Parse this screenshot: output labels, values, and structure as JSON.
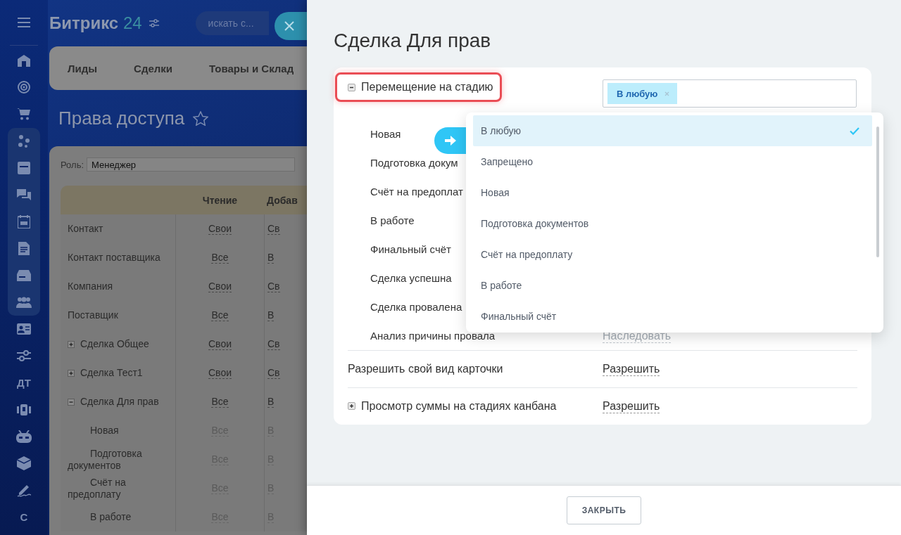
{
  "sidebar": {
    "text_items": [
      "ДТ",
      "С"
    ]
  },
  "header": {
    "logo_text": "Битрикс",
    "logo_number": "24",
    "search": {
      "placeholder": "искать с..."
    }
  },
  "nav_tabs": [
    "Лиды",
    "Сделки",
    "Товары и Склад"
  ],
  "page_title": "Права доступа",
  "role": {
    "label": "Роль:",
    "value": "Менеджер"
  },
  "table": {
    "columns": [
      "Чтение",
      "Добав"
    ],
    "rows": [
      {
        "name": "Контакт",
        "values": [
          "Свои",
          "Св"
        ],
        "inherited": false
      },
      {
        "name": "Контакт поставщика",
        "values": [
          "Все",
          "В"
        ],
        "inherited": false
      },
      {
        "name": "Компания",
        "values": [
          "Свои",
          "Св"
        ],
        "inherited": false
      },
      {
        "name": "Поставщик",
        "values": [
          "Все",
          "В"
        ],
        "inherited": false
      },
      {
        "name": "Сделка Общее",
        "values": [
          "Свои",
          "Св"
        ],
        "inherited": false,
        "expanded": false
      },
      {
        "name": "Сделка Тест1",
        "values": [
          "Свои",
          "Св"
        ],
        "inherited": false,
        "expanded": false
      },
      {
        "name": "Сделка Для прав",
        "values": [
          "Все",
          "В"
        ],
        "inherited": false,
        "expanded": true,
        "children": [
          {
            "name": "Новая",
            "values": [
              "Все",
              "В"
            ],
            "inherited": true
          },
          {
            "name": "Подготовка документов",
            "values": [
              "Все",
              "В"
            ],
            "inherited": true
          },
          {
            "name": "Счёт на предоплату",
            "values": [
              "Все",
              "В"
            ],
            "inherited": true
          },
          {
            "name": "В работе",
            "values": [
              "Все",
              "В"
            ],
            "inherited": true
          }
        ]
      }
    ]
  },
  "panel": {
    "title": "Сделка Для прав",
    "permissions": [
      {
        "label": "Перемещение на стадию",
        "expanded": true,
        "highlighted": true,
        "tags": [
          "В любую"
        ],
        "children": [
          {
            "label": "Новая"
          },
          {
            "label": "Подготовка докум"
          },
          {
            "label": "Счёт на предоплат"
          },
          {
            "label": "В работе"
          },
          {
            "label": "Финальный счёт"
          },
          {
            "label": "Сделка успешна"
          },
          {
            "label": "Сделка провалена"
          },
          {
            "label": "Анализ причины провала",
            "value": "Наследовать"
          }
        ]
      },
      {
        "label": "Разрешить свой вид карточки",
        "highlighted": false,
        "value": "Разрешить"
      },
      {
        "label": "Просмотр суммы на стадиях канбана",
        "expanded": false,
        "highlighted": false,
        "value": "Разрешить"
      }
    ],
    "dropdown": {
      "options": [
        {
          "label": "В любую",
          "selected": true
        },
        {
          "label": "Запрещено",
          "selected": false
        },
        {
          "label": "Новая",
          "selected": false
        },
        {
          "label": "Подготовка документов",
          "selected": false
        },
        {
          "label": "Счёт на предоплату",
          "selected": false
        },
        {
          "label": "В работе",
          "selected": false
        },
        {
          "label": "Финальный счёт",
          "selected": false
        }
      ]
    },
    "close_button": "ЗАКРЫТЬ"
  }
}
